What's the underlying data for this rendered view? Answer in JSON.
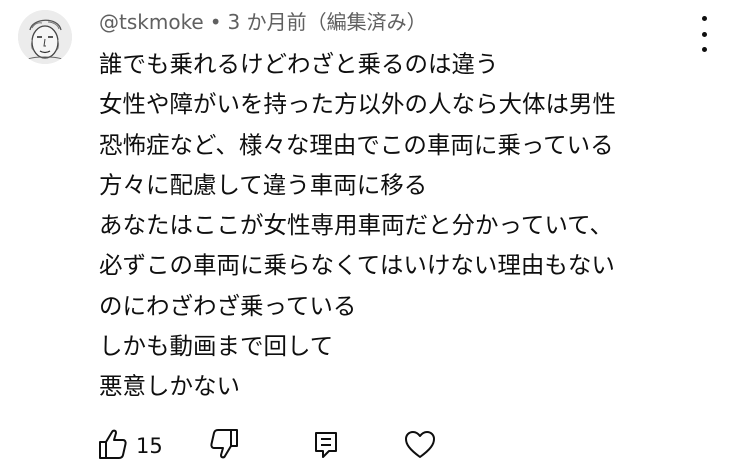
{
  "comment": {
    "handle": "@tskmoke",
    "separator": "•",
    "timestamp": "3 か月前（編集済み）",
    "lines": [
      "誰でも乗れるけどわざと乗るのは違う",
      "女性や障がいを持った方以外の人なら大体は男性",
      "恐怖症など、様々な理由でこの車両に乗っている",
      "方々に配慮して違う車両に移る",
      "あなたはここが女性専用車両だと分かっていて、",
      "必ずこの車両に乗らなくてはいけない理由もない",
      "のにわざわざ乗っている",
      "しかも動画まで回して",
      "悪意しかない"
    ]
  },
  "actions": {
    "like_count": "15"
  },
  "icons": {
    "avatar": "sketch-face-avatar",
    "menu": "more-vertical-icon",
    "like": "thumbs-up-icon",
    "dislike": "thumbs-down-icon",
    "reply": "reply-comment-icon",
    "heart": "heart-icon"
  }
}
